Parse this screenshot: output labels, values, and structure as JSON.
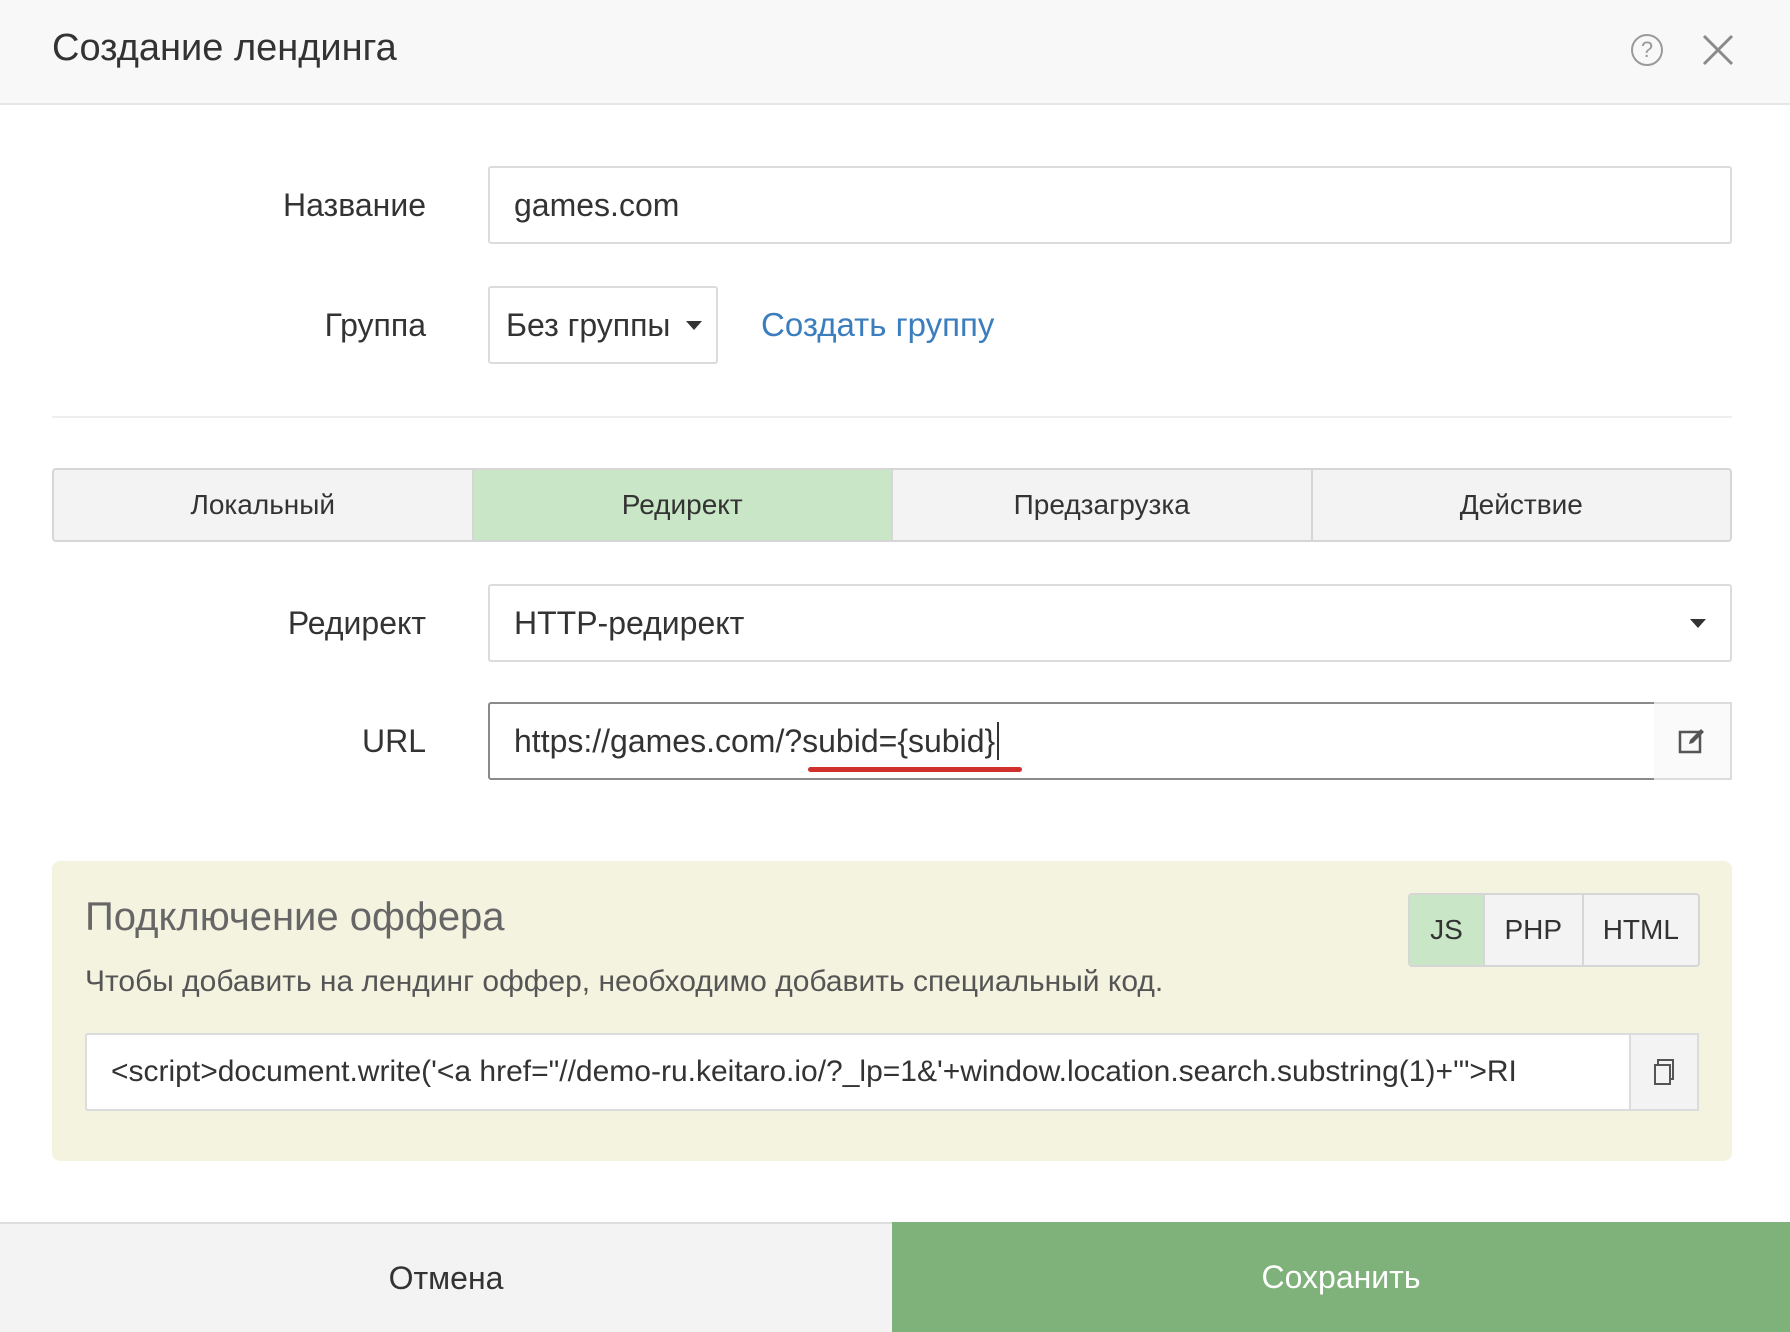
{
  "dialog": {
    "title": "Создание лендинга"
  },
  "form": {
    "name_label": "Название",
    "name_value": "games.com",
    "group_label": "Группа",
    "group_value": "Без группы",
    "create_group_link": "Создать группу",
    "redirect_label": "Редирект",
    "redirect_value": "HTTP-редирект",
    "url_label": "URL",
    "url_value": "https://games.com/?subid={subid}"
  },
  "tabs": [
    {
      "label": "Локальный",
      "active": false
    },
    {
      "label": "Редирект",
      "active": true
    },
    {
      "label": "Предзагрузка",
      "active": false
    },
    {
      "label": "Действие",
      "active": false
    }
  ],
  "offer": {
    "title": "Подключение оффера",
    "description": "Чтобы добавить на лендинг оффер, необходимо добавить специальный код.",
    "code": "<script>document.write('<a href=\"//demo-ru.keitaro.io/?_lp=1&'+window.location.search.substring(1)+'\">RI",
    "lang_buttons": [
      {
        "label": "JS",
        "active": true
      },
      {
        "label": "PHP",
        "active": false
      },
      {
        "label": "HTML",
        "active": false
      }
    ]
  },
  "footer": {
    "cancel_label": "Отмена",
    "save_label": "Сохранить"
  },
  "colors": {
    "accent_green": "#7fb27a",
    "active_tab": "#c9e6c6",
    "link_blue": "#3b7dbd",
    "offer_panel": "#f4f3e0",
    "underline_red": "#d0312d"
  },
  "icons": {
    "help": "help-circle-icon",
    "close": "close-icon",
    "edit": "edit-icon",
    "copy": "copy-icon",
    "caret": "chevron-down-icon"
  }
}
